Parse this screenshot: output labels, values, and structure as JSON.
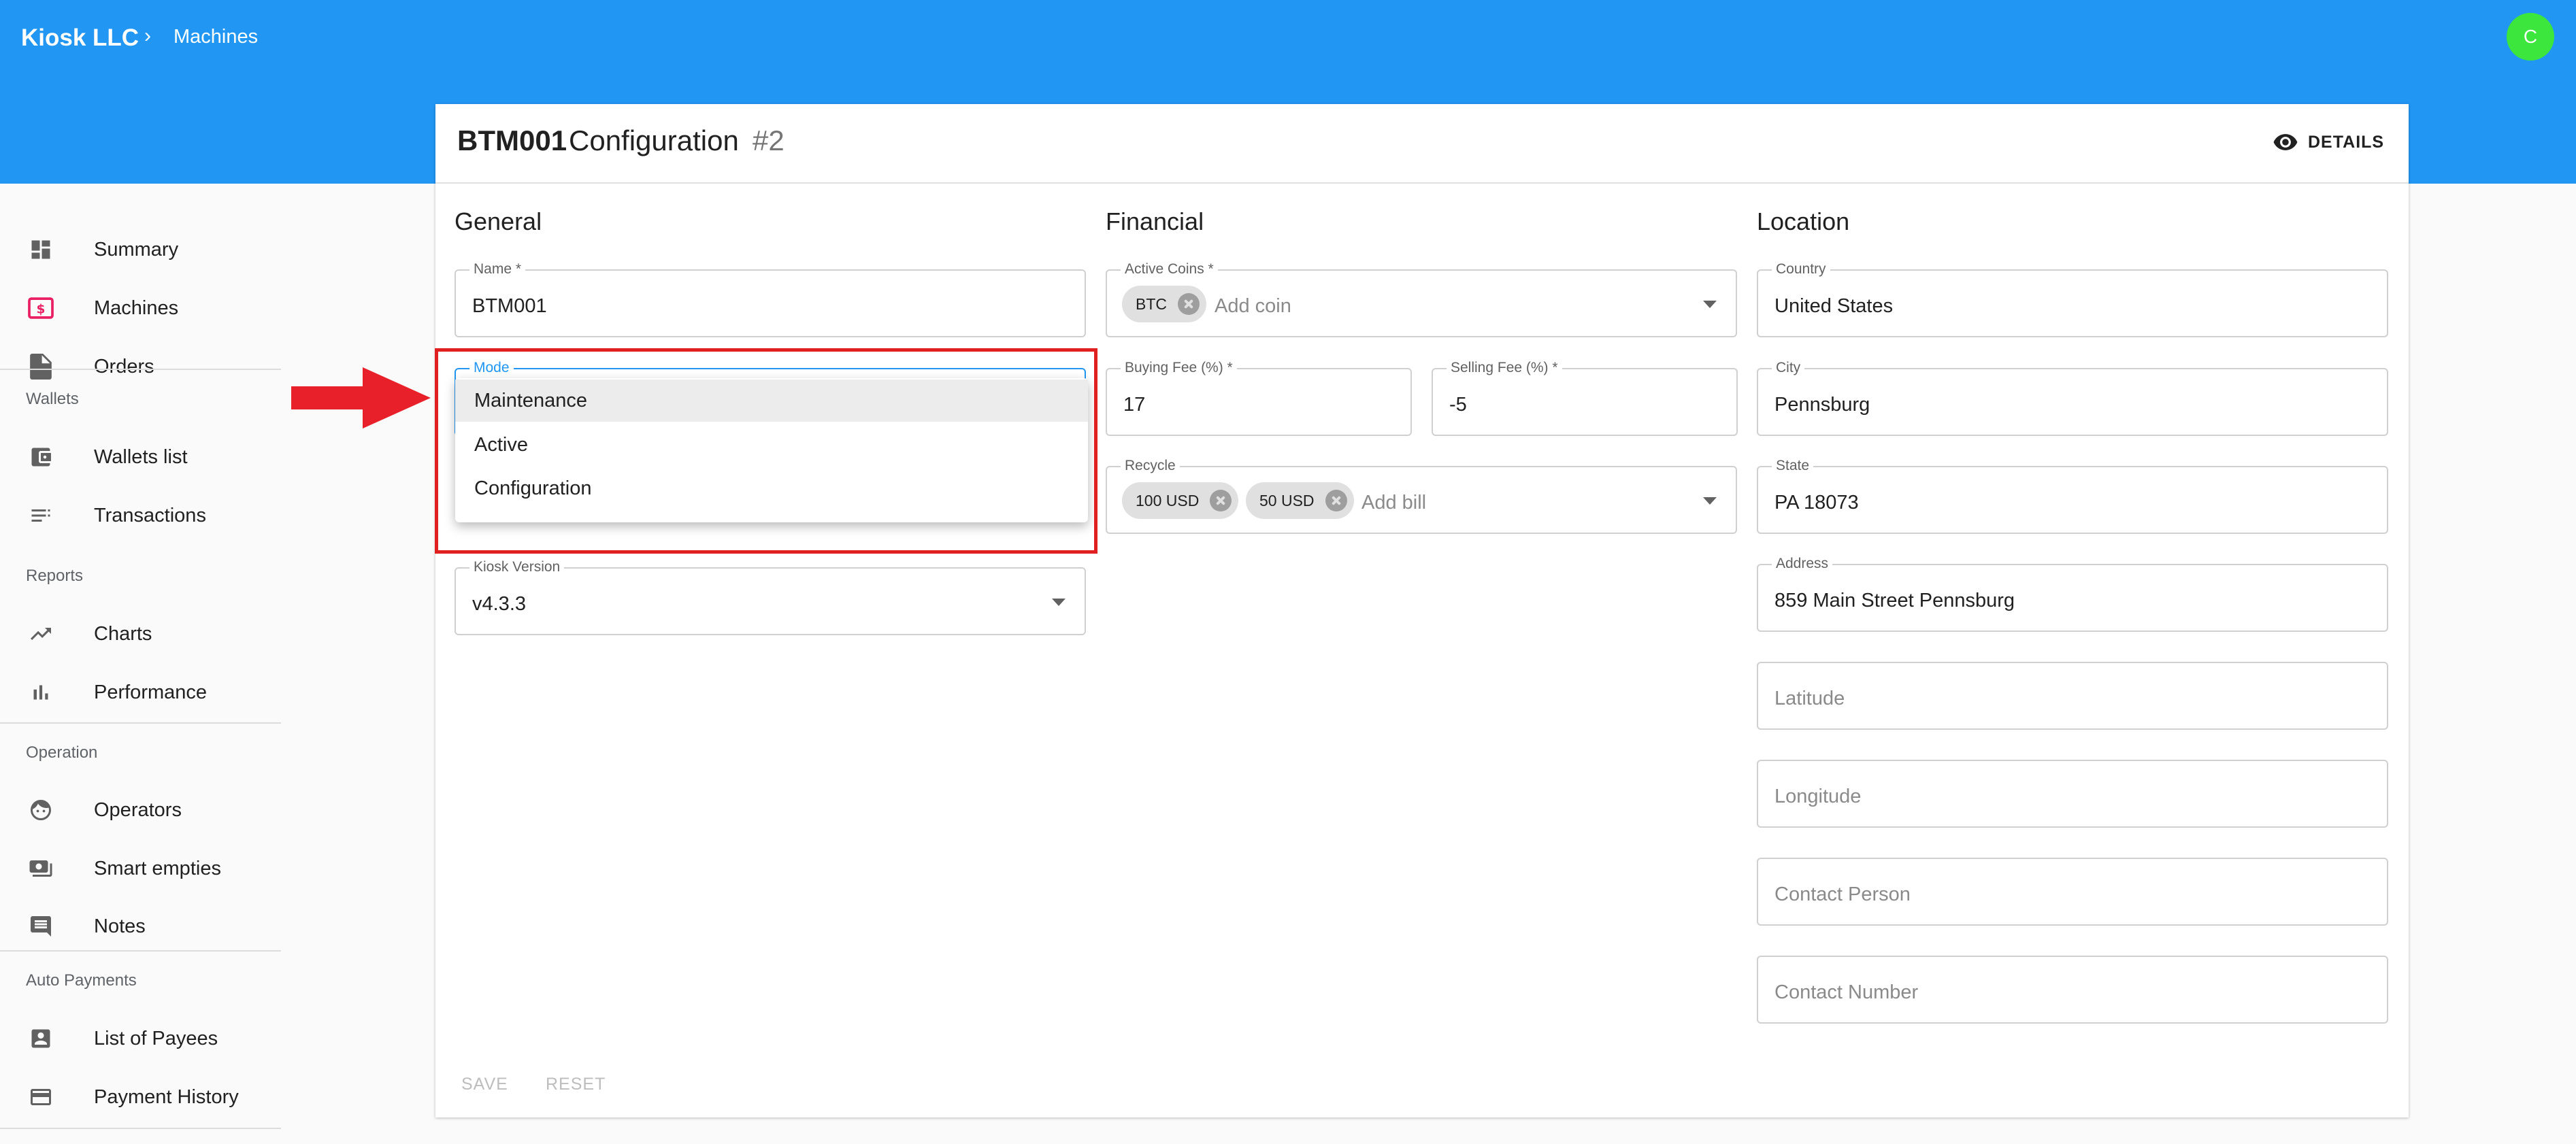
{
  "breadcrumb": {
    "company": "Kiosk LLC",
    "separator": "›",
    "page": "Machines"
  },
  "avatar": {
    "initial": "C",
    "color": "#3ce63c"
  },
  "colors": {
    "appbar": "#2196f3",
    "highlight": "#e02020"
  },
  "sidebar": {
    "items": [
      {
        "label": "Summary",
        "icon": "dashboard-icon"
      },
      {
        "label": "Machines",
        "icon": "machines-icon"
      },
      {
        "label": "Orders",
        "icon": "document-icon"
      },
      {
        "label": "Wallets list",
        "icon": "wallet-icon"
      },
      {
        "label": "Transactions",
        "icon": "list-icon"
      },
      {
        "label": "Charts",
        "icon": "trending-icon"
      },
      {
        "label": "Performance",
        "icon": "bar-chart-icon"
      },
      {
        "label": "Operators",
        "icon": "face-icon"
      },
      {
        "label": "Smart empties",
        "icon": "cash-icon"
      },
      {
        "label": "Notes",
        "icon": "comment-icon"
      },
      {
        "label": "List of Payees",
        "icon": "account-box-icon"
      },
      {
        "label": "Payment History",
        "icon": "credit-card-icon"
      }
    ],
    "sections": {
      "wallets": "Wallets",
      "reports": "Reports",
      "operation": "Operation",
      "auto_payments": "Auto Payments"
    }
  },
  "card": {
    "title_id": "BTM001",
    "title_config": "Configuration",
    "title_number": "#2",
    "details_label": "DETAILS"
  },
  "general": {
    "title": "General",
    "name": {
      "label": "Name *",
      "value": "BTM001"
    },
    "mode": {
      "label": "Mode"
    },
    "kiosk_version": {
      "label": "Kiosk Version",
      "value": "v4.3.3"
    }
  },
  "mode_menu": {
    "options": [
      "Maintenance",
      "Active",
      "Configuration"
    ],
    "highlighted": "Maintenance"
  },
  "financial": {
    "title": "Financial",
    "active_coins": {
      "label": "Active Coins *",
      "chips": [
        "BTC"
      ],
      "placeholder": "Add coin"
    },
    "buying_fee": {
      "label": "Buying Fee (%) *",
      "value": "17"
    },
    "selling_fee": {
      "label": "Selling Fee (%) *",
      "value": "-5"
    },
    "recycle": {
      "label": "Recycle",
      "chips": [
        "100 USD",
        "50 USD"
      ],
      "placeholder": "Add bill"
    }
  },
  "location": {
    "title": "Location",
    "country": {
      "label": "Country",
      "value": "United States"
    },
    "city": {
      "label": "City",
      "value": "Pennsburg"
    },
    "state": {
      "label": "State",
      "value": "PA 18073"
    },
    "address": {
      "label": "Address",
      "value": "859 Main Street Pennsburg"
    },
    "latitude": {
      "placeholder": "Latitude"
    },
    "longitude": {
      "placeholder": "Longitude"
    },
    "contact_person": {
      "placeholder": "Contact Person"
    },
    "contact_number": {
      "placeholder": "Contact Number"
    }
  },
  "footer": {
    "save": "SAVE",
    "reset": "RESET"
  }
}
